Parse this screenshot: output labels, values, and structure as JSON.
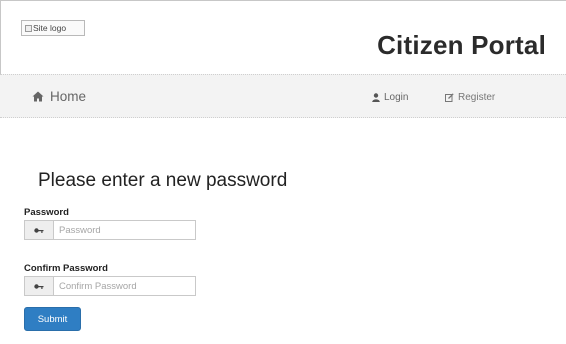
{
  "header": {
    "logo_alt": "Site logo",
    "brand_title": "Citizen Portal"
  },
  "nav": {
    "home_label": "Home",
    "login_label": "Login",
    "register_label": "Register"
  },
  "form": {
    "title": "Please enter a new password",
    "password": {
      "label": "Password",
      "placeholder": "Password",
      "value": ""
    },
    "confirm_password": {
      "label": "Confirm Password",
      "placeholder": "Confirm Password",
      "value": ""
    },
    "submit_label": "Submit"
  },
  "icons": {
    "home": "home-icon",
    "login": "user-icon",
    "register": "edit-icon",
    "password_addon": "key-icon",
    "confirm_addon": "key-icon"
  },
  "colors": {
    "primary_button": "#2f7ec3",
    "navbar_bg": "#f3f3f3"
  }
}
